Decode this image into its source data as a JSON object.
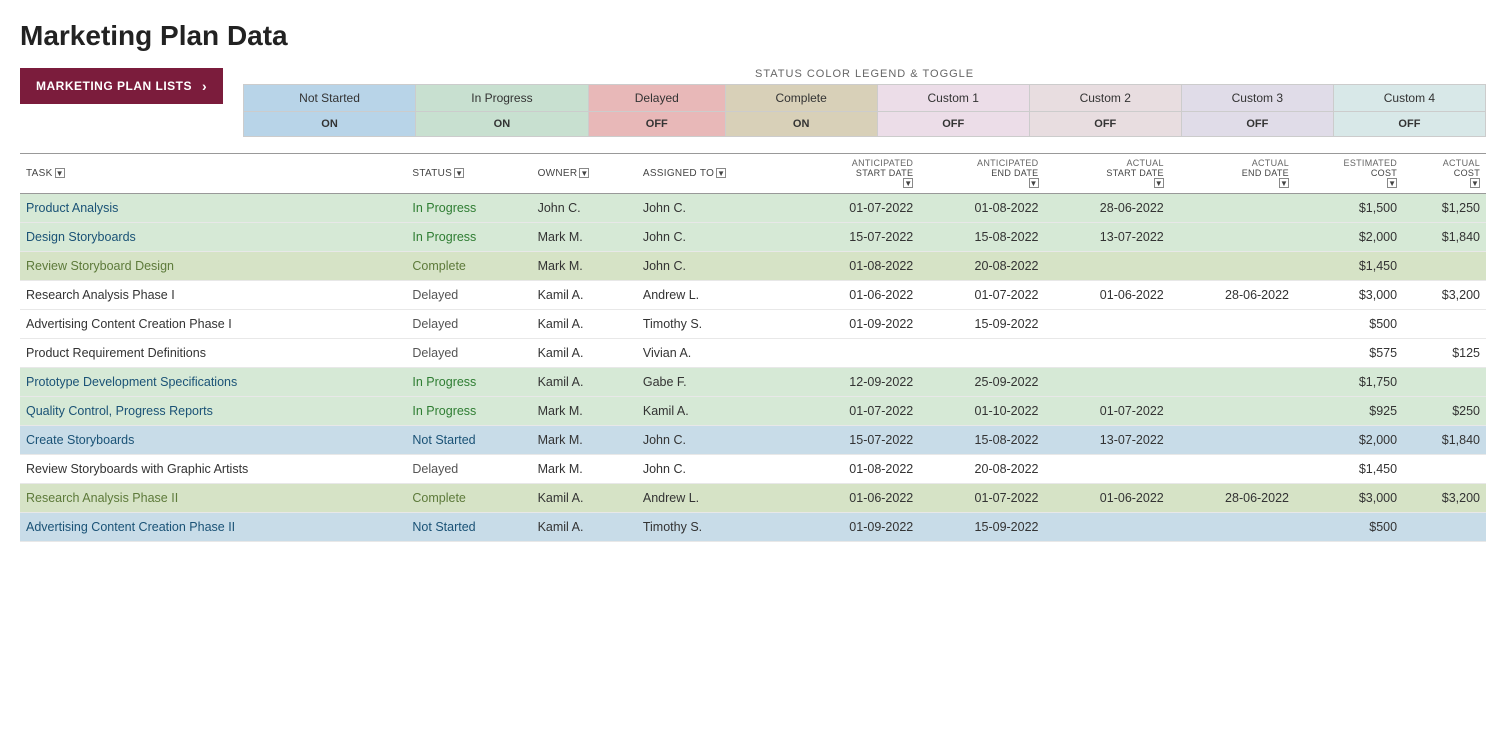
{
  "page": {
    "title": "Marketing Plan Data"
  },
  "sidebar_button": {
    "label": "MARKETING PLAN LISTS",
    "chevron": "›"
  },
  "legend": {
    "title": "STATUS COLOR LEGEND & TOGGLE",
    "statuses": [
      {
        "name": "Not Started",
        "toggle": "ON",
        "headerClass": "status-not-started-header"
      },
      {
        "name": "In Progress",
        "toggle": "ON",
        "headerClass": "status-in-progress-header"
      },
      {
        "name": "Delayed",
        "toggle": "OFF",
        "headerClass": "status-delayed-header"
      },
      {
        "name": "Complete",
        "toggle": "ON",
        "headerClass": "status-complete-header"
      },
      {
        "name": "Custom 1",
        "toggle": "OFF",
        "headerClass": "status-custom1-header"
      },
      {
        "name": "Custom 2",
        "toggle": "OFF",
        "headerClass": "status-custom2-header"
      },
      {
        "name": "Custom 3",
        "toggle": "OFF",
        "headerClass": "status-custom3-header"
      },
      {
        "name": "Custom 4",
        "toggle": "OFF",
        "headerClass": "status-custom4-header"
      }
    ]
  },
  "table": {
    "columns": [
      {
        "key": "task",
        "label": "TASK",
        "filterable": true
      },
      {
        "key": "status",
        "label": "STATUS",
        "filterable": true
      },
      {
        "key": "owner",
        "label": "OWNER",
        "filterable": true
      },
      {
        "key": "assigned_to",
        "label": "ASSIGNED TO",
        "filterable": true
      },
      {
        "key": "ant_start",
        "label": "ANTICIPATED START DATE",
        "filterable": true
      },
      {
        "key": "ant_end",
        "label": "ANTICIPATED END DATE",
        "filterable": true
      },
      {
        "key": "act_start",
        "label": "ACTUAL START DATE",
        "filterable": true
      },
      {
        "key": "act_end",
        "label": "ACTUAL END DATE",
        "filterable": true
      },
      {
        "key": "est_cost",
        "label": "ESTIMATED COST",
        "filterable": true
      },
      {
        "key": "act_cost",
        "label": "ACTUAL COST",
        "filterable": true
      }
    ],
    "rows": [
      {
        "task": "Product Analysis",
        "status": "In Progress",
        "owner": "John C.",
        "assigned_to": "John C.",
        "ant_start": "01-07-2022",
        "ant_end": "01-08-2022",
        "act_start": "28-06-2022",
        "act_end": "",
        "est_cost": "$1,500",
        "act_cost": "$1,250",
        "rowClass": "row-in-progress"
      },
      {
        "task": "Design Storyboards",
        "status": "In Progress",
        "owner": "Mark M.",
        "assigned_to": "John C.",
        "ant_start": "15-07-2022",
        "ant_end": "15-08-2022",
        "act_start": "13-07-2022",
        "act_end": "",
        "est_cost": "$2,000",
        "act_cost": "$1,840",
        "rowClass": "row-in-progress"
      },
      {
        "task": "Review Storyboard Design",
        "status": "Complete",
        "owner": "Mark M.",
        "assigned_to": "John C.",
        "ant_start": "01-08-2022",
        "ant_end": "20-08-2022",
        "act_start": "",
        "act_end": "",
        "est_cost": "$1,450",
        "act_cost": "",
        "rowClass": "row-complete"
      },
      {
        "task": "Research Analysis Phase I",
        "status": "Delayed",
        "owner": "Kamil A.",
        "assigned_to": "Andrew L.",
        "ant_start": "01-06-2022",
        "ant_end": "01-07-2022",
        "act_start": "01-06-2022",
        "act_end": "28-06-2022",
        "est_cost": "$3,000",
        "act_cost": "$3,200",
        "rowClass": "row-delayed"
      },
      {
        "task": "Advertising Content Creation Phase I",
        "status": "Delayed",
        "owner": "Kamil A.",
        "assigned_to": "Timothy S.",
        "ant_start": "01-09-2022",
        "ant_end": "15-09-2022",
        "act_start": "",
        "act_end": "",
        "est_cost": "$500",
        "act_cost": "",
        "rowClass": "row-delayed"
      },
      {
        "task": "Product Requirement Definitions",
        "status": "Delayed",
        "owner": "Kamil A.",
        "assigned_to": "Vivian A.",
        "ant_start": "",
        "ant_end": "",
        "act_start": "",
        "act_end": "",
        "est_cost": "$575",
        "act_cost": "$125",
        "rowClass": "row-delayed"
      },
      {
        "task": "Prototype Development Specifications",
        "status": "In Progress",
        "owner": "Kamil A.",
        "assigned_to": "Gabe F.",
        "ant_start": "12-09-2022",
        "ant_end": "25-09-2022",
        "act_start": "",
        "act_end": "",
        "est_cost": "$1,750",
        "act_cost": "",
        "rowClass": "row-in-progress"
      },
      {
        "task": "Quality Control, Progress Reports",
        "status": "In Progress",
        "owner": "Mark M.",
        "assigned_to": "Kamil A.",
        "ant_start": "01-07-2022",
        "ant_end": "01-10-2022",
        "act_start": "01-07-2022",
        "act_end": "",
        "est_cost": "$925",
        "act_cost": "$250",
        "rowClass": "row-in-progress"
      },
      {
        "task": "Create Storyboards",
        "status": "Not Started",
        "owner": "Mark M.",
        "assigned_to": "John C.",
        "ant_start": "15-07-2022",
        "ant_end": "15-08-2022",
        "act_start": "13-07-2022",
        "act_end": "",
        "est_cost": "$2,000",
        "act_cost": "$1,840",
        "rowClass": "row-not-started"
      },
      {
        "task": "Review Storyboards with Graphic Artists",
        "status": "Delayed",
        "owner": "Mark M.",
        "assigned_to": "John C.",
        "ant_start": "01-08-2022",
        "ant_end": "20-08-2022",
        "act_start": "",
        "act_end": "",
        "est_cost": "$1,450",
        "act_cost": "",
        "rowClass": "row-delayed"
      },
      {
        "task": "Research Analysis Phase II",
        "status": "Complete",
        "owner": "Kamil A.",
        "assigned_to": "Andrew L.",
        "ant_start": "01-06-2022",
        "ant_end": "01-07-2022",
        "act_start": "01-06-2022",
        "act_end": "28-06-2022",
        "est_cost": "$3,000",
        "act_cost": "$3,200",
        "rowClass": "row-complete"
      },
      {
        "task": "Advertising Content Creation Phase II",
        "status": "Not Started",
        "owner": "Kamil A.",
        "assigned_to": "Timothy S.",
        "ant_start": "01-09-2022",
        "ant_end": "15-09-2022",
        "act_start": "",
        "act_end": "",
        "est_cost": "$500",
        "act_cost": "",
        "rowClass": "row-not-started"
      }
    ]
  }
}
